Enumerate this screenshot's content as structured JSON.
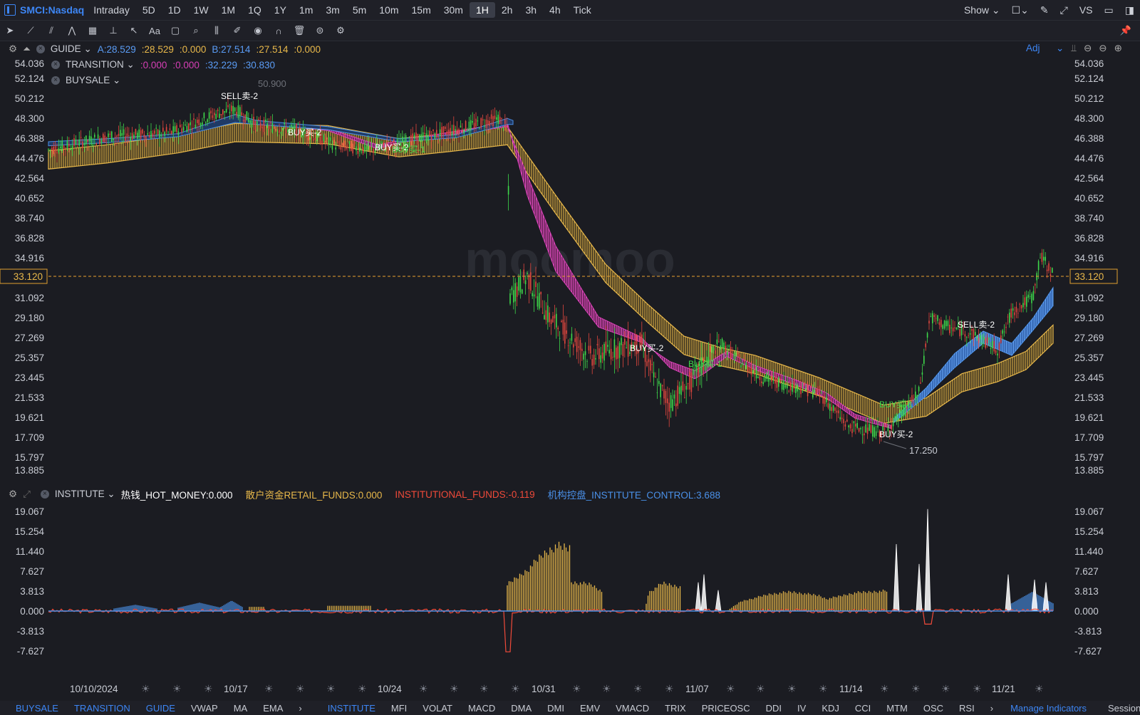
{
  "header": {
    "symbol": "SMCI:Nasdaq",
    "timeframes": [
      "Intraday",
      "5D",
      "1D",
      "1W",
      "1M",
      "1Q",
      "1Y",
      "1m",
      "3m",
      "5m",
      "10m",
      "15m",
      "30m",
      "1H",
      "2h",
      "3h",
      "4h",
      "Tick"
    ],
    "active_timeframe": "1H",
    "show_label": "Show",
    "vs_label": "VS"
  },
  "legends": {
    "guide": {
      "name": "GUIDE",
      "a": "A:28.529",
      "v2": ":28.529",
      ":v3": ":0.000",
      "b": "B:27.514",
      "v5": ":27.514",
      "v6": ":0.000"
    },
    "transition": {
      "name": "TRANSITION",
      "v1": ":0.000",
      "v2": ":0.000",
      "v3": ":32.229",
      "v4": ":30.830"
    },
    "buysale": {
      "name": "BUYSALE"
    },
    "adj_label": "Adj"
  },
  "price_axis": {
    "ticks": [
      "54.036",
      "52.124",
      "50.212",
      "48.300",
      "46.388",
      "44.476",
      "42.564",
      "40.652",
      "38.740",
      "36.828",
      "34.916",
      "31.092",
      "29.180",
      "27.269",
      "25.357",
      "23.445",
      "21.533",
      "19.621",
      "17.709",
      "15.797",
      "13.885"
    ],
    "current_price": "33.120",
    "high_label": "50.900",
    "low_label": "17.250"
  },
  "annotations": [
    {
      "text": "SELL卖-2",
      "color": "#ffffff"
    },
    {
      "text": "BUY买-2",
      "color": "#ffffff"
    },
    {
      "text": "BUY买-2",
      "color": "#ffffff"
    },
    {
      "text": "BUY买-1",
      "color": "#3ed84a"
    },
    {
      "text": "BUY买-2",
      "color": "#ffffff"
    },
    {
      "text": "BUY买-1",
      "color": "#3ed84a"
    },
    {
      "text": "BUY买-1",
      "color": "#3ed84a"
    },
    {
      "text": "BUY买-2",
      "color": "#ffffff"
    },
    {
      "text": "SELL卖-2",
      "color": "#ffffff"
    }
  ],
  "watermark": "moomoo",
  "institute": {
    "name": "INSTITUTE",
    "hot_money": "热钱_HOT_MONEY:0.000",
    "retail": "散户资金RETAIL_FUNDS:0.000",
    "institutional": "INSTITUTIONAL_FUNDS:-0.119",
    "control": "机构控盘_INSTITUTE_CONTROL:3.688",
    "ticks": [
      "19.067",
      "15.254",
      "11.440",
      "7.627",
      "3.813",
      "0.000",
      "-3.813",
      "-7.627"
    ]
  },
  "date_axis": [
    "10/10/2024",
    "10/17",
    "10/24",
    "10/31",
    "11/07",
    "11/14",
    "11/21"
  ],
  "bottom_tabs_left": [
    "BUYSALE",
    "TRANSITION",
    "GUIDE",
    "VWAP",
    "MA",
    "EMA"
  ],
  "bottom_tabs_right": [
    "INSTITUTE",
    "MFI",
    "VOLAT",
    "MACD",
    "DMA",
    "DMI",
    "EMV",
    "VMACD",
    "TRIX",
    "PRICEOSC",
    "DDI",
    "IV",
    "KDJ",
    "CCI",
    "MTM",
    "OSC",
    "RSI"
  ],
  "manage_label": "Manage Indicators",
  "session_label": "Session",
  "colors": {
    "accent": "#3d86f5",
    "guide": "#e8b84a",
    "transition": "#d63fb5",
    "institutional": "#f04a3a",
    "retail": "#e8b84a",
    "up": "#3ed84a",
    "down": "#e0463e"
  }
}
